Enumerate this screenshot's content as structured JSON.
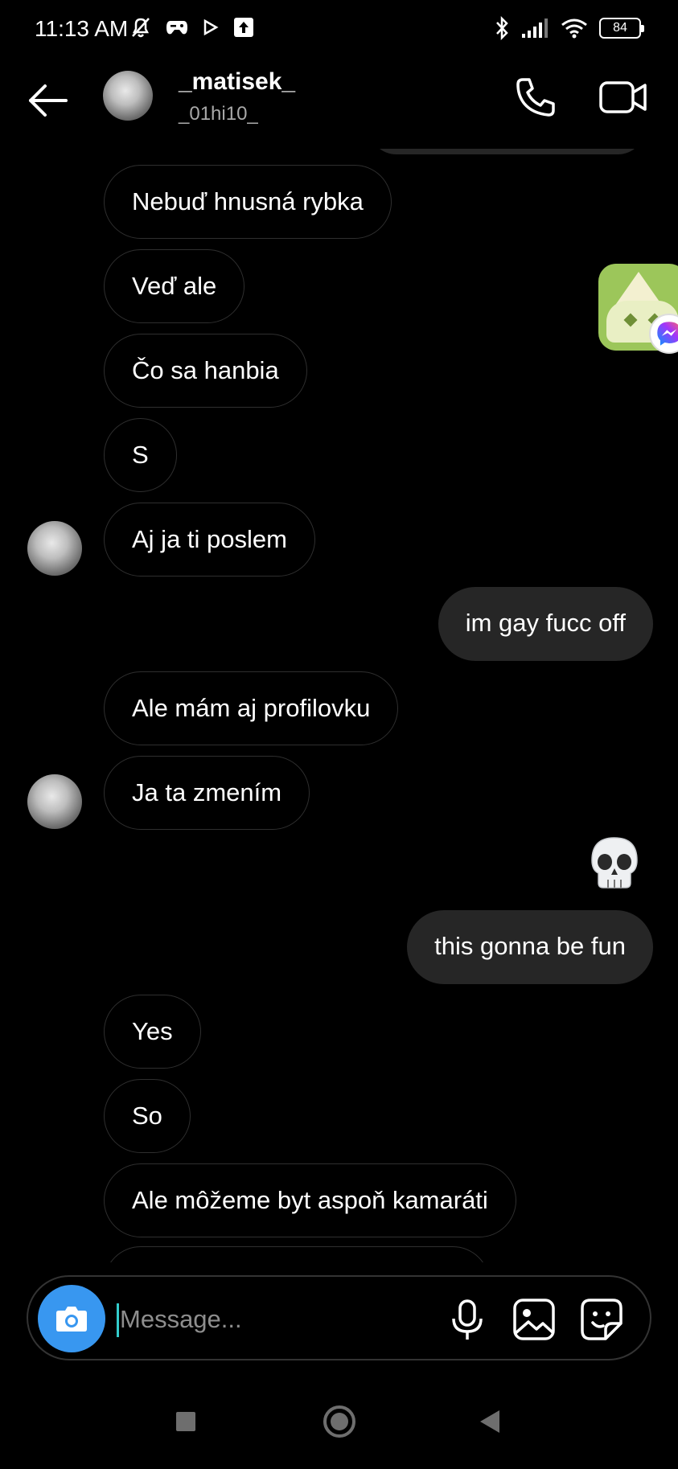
{
  "status_bar": {
    "time": "11:13 AM",
    "battery": "84",
    "icons": [
      "mute-bell-icon",
      "game-icon",
      "play-icon",
      "upload-icon",
      "bluetooth-icon",
      "signal-icon",
      "wifi-icon",
      "battery-icon"
    ]
  },
  "header": {
    "username": "_matisek_",
    "subtitle": "_01hi10_",
    "icons": [
      "back-arrow-icon",
      "phone-icon",
      "video-camera-icon"
    ]
  },
  "messages": [
    {
      "side": "in",
      "text": "Nebuď hnusná rybka",
      "avatar": false
    },
    {
      "side": "in",
      "text": "Veď ale",
      "avatar": false
    },
    {
      "side": "in",
      "text": "Čo sa hanbia",
      "avatar": false
    },
    {
      "side": "in",
      "text": "S",
      "avatar": false
    },
    {
      "side": "in",
      "text": "Aj ja ti poslem",
      "avatar": true
    },
    {
      "side": "out",
      "text": "im gay fucc off",
      "avatar": false
    },
    {
      "side": "in",
      "text": "Ale mám aj profilovku",
      "avatar": false
    },
    {
      "side": "in",
      "text": "Ja ta zmením",
      "avatar": true
    },
    {
      "side": "out",
      "emoji": "💀"
    },
    {
      "side": "out",
      "text": "this gonna be fun",
      "avatar": false
    },
    {
      "side": "in",
      "text": "Yes",
      "avatar": false
    },
    {
      "side": "in",
      "text": "So",
      "avatar": false
    },
    {
      "side": "in",
      "text": "Ale môžeme byt aspoň kamaráti",
      "avatar": false
    }
  ],
  "composer": {
    "placeholder": "Message...",
    "icons": [
      "camera-icon",
      "microphone-icon",
      "gallery-icon",
      "sticker-icon"
    ]
  },
  "colors": {
    "background": "#000000",
    "outgoing_bubble": "#262626",
    "incoming_border": "#2f2f2f",
    "camera_button": "#3897f0",
    "secondary_text": "#a8a8a8"
  }
}
